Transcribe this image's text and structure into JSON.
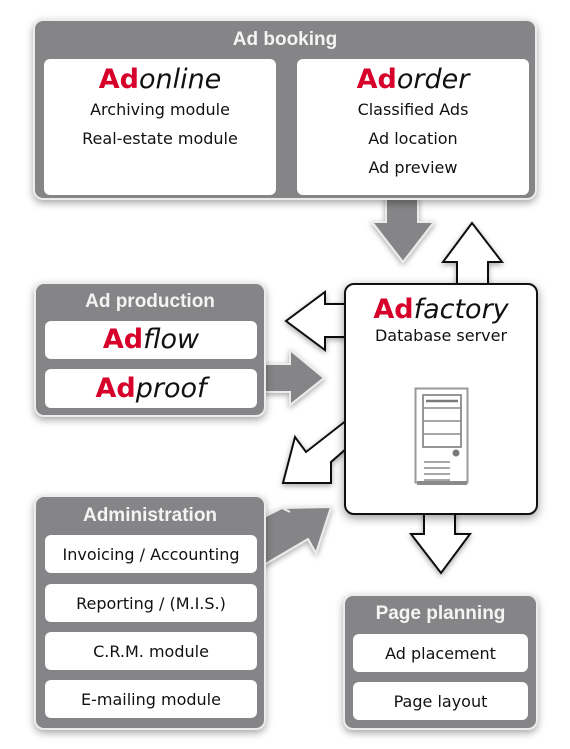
{
  "colors": {
    "group_fill": "#858587",
    "brand_red": "#d6002a",
    "panel_fill": "#ffffff",
    "arrow_gray": "#858587",
    "arrow_white": "#ffffff"
  },
  "ad_booking": {
    "title": "Ad booking",
    "adonline": {
      "brand_prefix": "Ad",
      "brand_suffix": "online",
      "lines": [
        "Archiving module",
        "Real-estate module"
      ]
    },
    "adorder": {
      "brand_prefix": "Ad",
      "brand_suffix": "order",
      "lines": [
        "Classified Ads",
        "Ad location",
        "Ad preview"
      ]
    }
  },
  "ad_production": {
    "title": "Ad production",
    "items": [
      {
        "brand_prefix": "Ad",
        "brand_suffix": "flow"
      },
      {
        "brand_prefix": "Ad",
        "brand_suffix": "proof"
      }
    ]
  },
  "adfactory": {
    "brand_prefix": "Ad",
    "brand_suffix": "factory",
    "subtitle": "Database server",
    "icon": "server-tower-icon"
  },
  "administration": {
    "title": "Administration",
    "items": [
      "Invoicing / Accounting",
      "Reporting  / (M.I.S.)",
      "C.R.M. module",
      "E-mailing module"
    ]
  },
  "page_planning": {
    "title": "Page planning",
    "items": [
      "Ad placement",
      "Page layout"
    ]
  },
  "flows": [
    {
      "from": "Ad booking",
      "to": "Adfactory",
      "style": "gray"
    },
    {
      "from": "Adfactory",
      "to": "Ad booking",
      "style": "white"
    },
    {
      "from": "Adfactory",
      "to": "Ad production",
      "style": "white"
    },
    {
      "from": "Ad production",
      "to": "Adfactory",
      "style": "gray"
    },
    {
      "from": "Adfactory",
      "to": "Administration",
      "style": "white"
    },
    {
      "from": "Administration",
      "to": "Adfactory",
      "style": "gray"
    },
    {
      "from": "Adfactory",
      "to": "Page planning",
      "style": "white"
    }
  ]
}
